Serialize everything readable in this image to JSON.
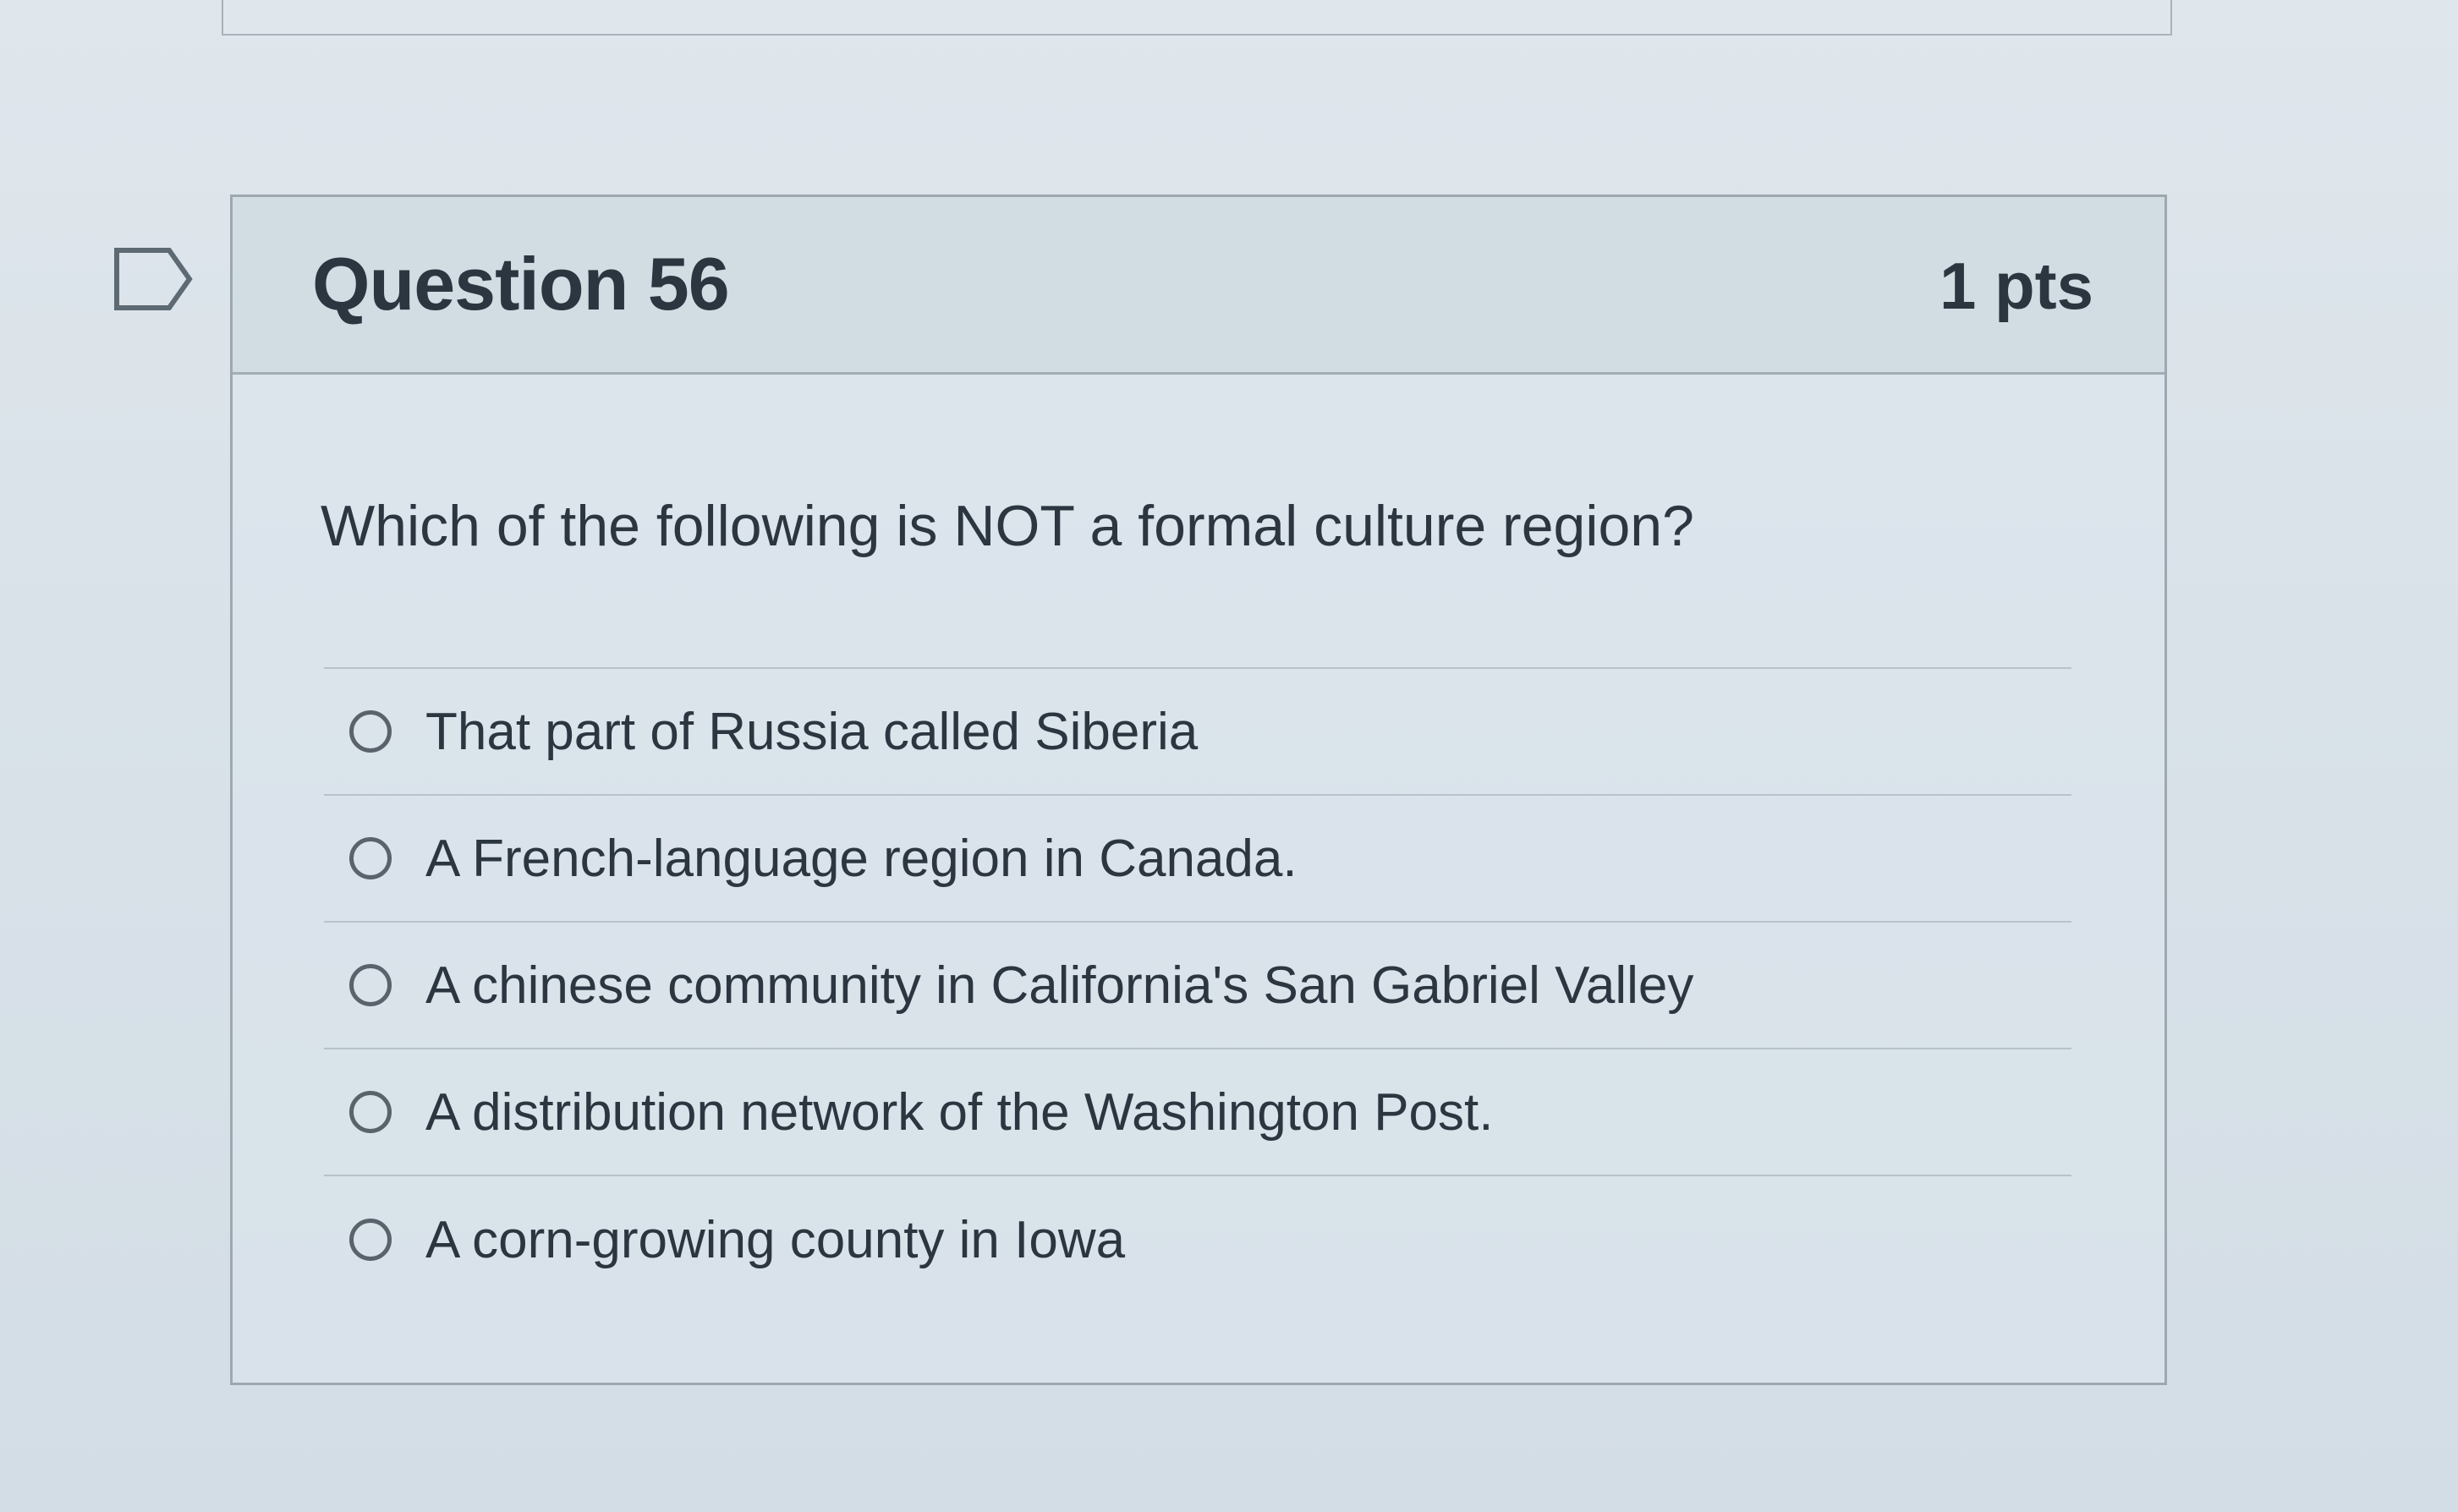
{
  "question": {
    "title": "Question 56",
    "points": "1 pts",
    "text": "Which of the following is NOT a formal culture region?",
    "flag_icon": "bookmark-flag-icon",
    "answers": [
      {
        "label": "That part of Russia called Siberia"
      },
      {
        "label": "A French-language region in Canada."
      },
      {
        "label": "A chinese community in California's San Gabriel Valley"
      },
      {
        "label": "A distribution network of the Washington Post."
      },
      {
        "label": "A corn-growing county in Iowa"
      }
    ]
  },
  "colors": {
    "background": "#dbe3ea",
    "header_background": "#ced8e0",
    "border": "#9ea8b0",
    "text": "#2b3640",
    "radio_border": "#5a636b"
  }
}
